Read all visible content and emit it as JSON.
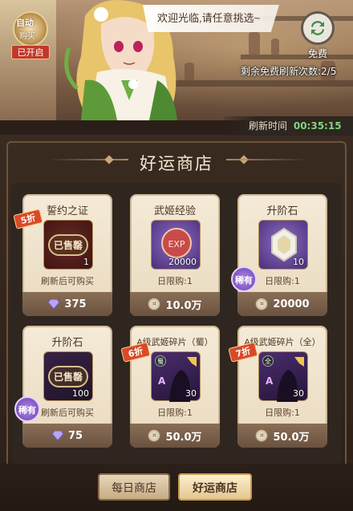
{
  "banner": {
    "welcome_text": "欢迎光临,请任意挑选~",
    "auto_badge": {
      "line1": "自动",
      "line2": "购买",
      "status": "已开启"
    },
    "refresh_button_label": "免费",
    "remaining_free_refresh": "剩余免费刷新次数:2/5",
    "refresh_time_label": "刷新时间",
    "refresh_time_value": "00:35:15"
  },
  "shop": {
    "title": "好运商店",
    "cards": [
      {
        "name": "誓约之证",
        "state": "已售罄",
        "qty": "1",
        "limit": "刷新后可购买",
        "price": "375",
        "currency": "diamond-icon",
        "discount": "5折",
        "rare": ""
      },
      {
        "name": "武姬经验",
        "state": "",
        "qty": "20000",
        "limit": "日限购:1",
        "price": "10.0万",
        "currency": "coin-icon",
        "discount": "",
        "rare": ""
      },
      {
        "name": "升阶石",
        "state": "",
        "qty": "10",
        "limit": "日限购:1",
        "price": "20000",
        "currency": "coin-icon",
        "discount": "",
        "rare": "稀有"
      },
      {
        "name": "升阶石",
        "state": "已售罄",
        "qty": "100",
        "limit": "刷新后可购买",
        "price": "75",
        "currency": "diamond-icon",
        "discount": "",
        "rare": "稀有"
      },
      {
        "name": "A级武姬碎片（蜀）",
        "state": "",
        "qty": "30",
        "limit": "日限购:1",
        "price": "50.0万",
        "currency": "coin-icon",
        "discount": "6折",
        "rare": "",
        "faction": "蜀"
      },
      {
        "name": "A级武姬碎片（全）",
        "state": "",
        "qty": "30",
        "limit": "日限购:1",
        "price": "50.0万",
        "currency": "coin-icon",
        "discount": "7折",
        "rare": "",
        "faction": "全"
      }
    ]
  },
  "tabs": {
    "daily": "每日商店",
    "lucky": "好运商店"
  },
  "colors": {
    "timer_green": "#7fd77a",
    "discount_red": "#d84a2a",
    "rare_purple": "#6b3fb0"
  }
}
